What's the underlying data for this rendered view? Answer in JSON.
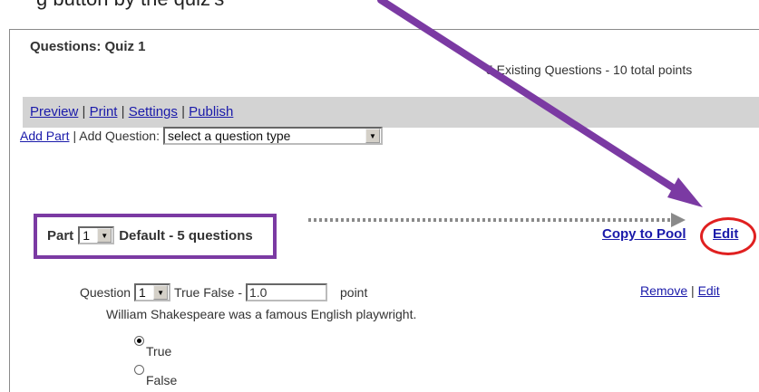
{
  "caption": "g button by the quiz's",
  "panel": {
    "title": "Questions: Quiz 1",
    "existing": "5 Existing Questions - 10 total points"
  },
  "toolbar": {
    "preview": "Preview",
    "print": "Print",
    "settings": "Settings",
    "publish": "Publish",
    "separator": "|"
  },
  "add_row": {
    "add_part": "Add Part",
    "add_question_label": "| Add Question:",
    "question_type_select": "select a question type"
  },
  "part": {
    "label": "Part",
    "number": "1",
    "name": "Default - 5 questions",
    "copy_to_pool": "Copy to Pool",
    "edit": "Edit"
  },
  "question": {
    "label": "Question",
    "number": "1",
    "type": "True False -",
    "points_value": "1.0",
    "points_unit": "point",
    "remove": "Remove",
    "separator": "|",
    "edit": "Edit",
    "text": "William Shakespeare was a famous English playwright.",
    "options": [
      {
        "label": "True",
        "selected": true
      },
      {
        "label": "False",
        "selected": false
      }
    ]
  },
  "annotation_colors": {
    "arrow": "#7b3aa3",
    "part_box": "#7b3aa3",
    "circle": "#e02020",
    "dotted_arrow": "#8a8a8a"
  }
}
